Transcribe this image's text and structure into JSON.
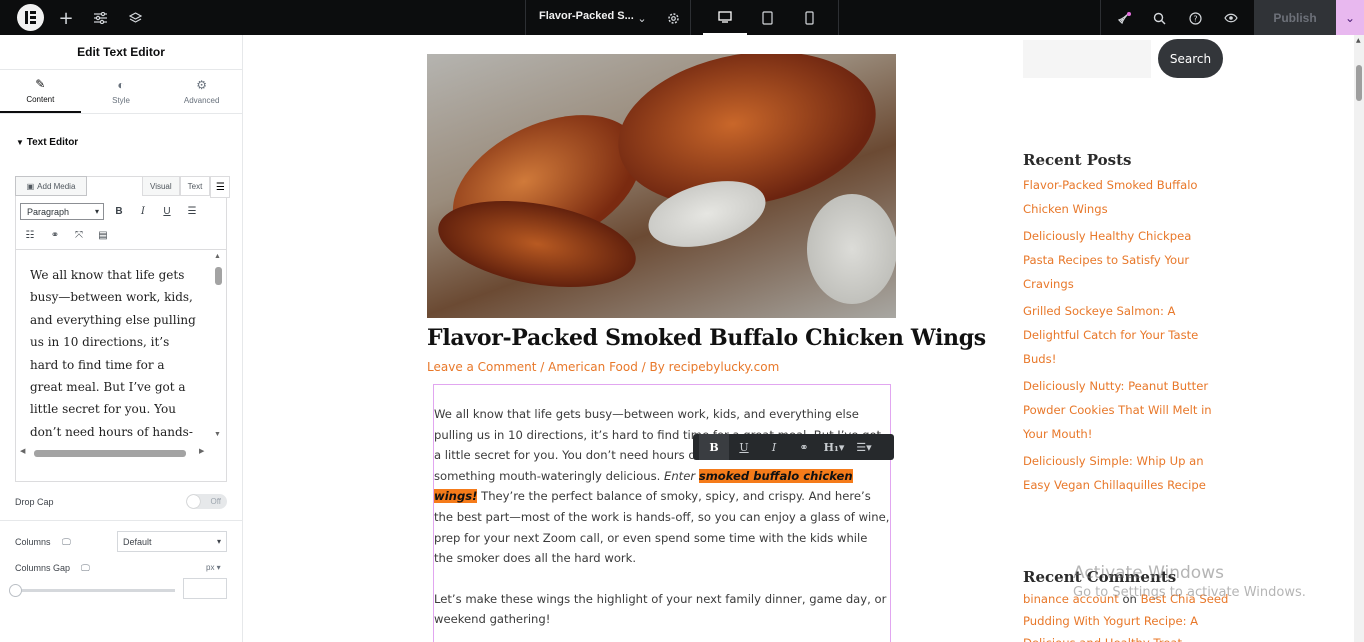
{
  "topbar": {
    "page_title": "Flavor-Packed S...",
    "publish_label": "Publish"
  },
  "panel": {
    "title": "Edit Text Editor",
    "tabs": [
      {
        "label": "Content",
        "icon": "pencil-icon"
      },
      {
        "label": "Style",
        "icon": "half-circle-icon"
      },
      {
        "label": "Advanced",
        "icon": "gear-icon"
      }
    ],
    "section_title": "Text Editor",
    "add_media_label": "Add Media",
    "visual_tab": "Visual",
    "text_tab": "Text",
    "format_select": "Paragraph",
    "editor_text": "We all know that life gets busy—between work, kids, and everything else pulling us in 10 directions, it’s hard to find time for a great meal. But I’ve got a little secret for you. You don’t need hours of hands-on time to make something",
    "drop_cap_label": "Drop Cap",
    "drop_cap_value": "Off",
    "columns_label": "Columns",
    "columns_value": "Default",
    "columns_gap_label": "Columns Gap",
    "columns_gap_unit": "px"
  },
  "post": {
    "title": "Flavor-Packed Smoked Buffalo Chicken Wings",
    "meta": "Leave a Comment / American Food / By recipebylucky.com",
    "para1_before": "We all know that life gets busy—between work, kids, and everything else pulling us in 10 directions, it’s hard to find time for a great meal. But I’ve got a little secret for you. You don’t need hours of hands-on time to make something mouth-wateringly delicious. ",
    "para1_enter": "Enter ",
    "para1_highlight": "smoked buffalo chicken wings",
    "para1_bang": "!",
    "para1_after": " They’re the perfect balance of smoky, spicy, and crispy. And here’s the best part—most of the work is hands-off, so you can enjoy a glass of wine, prep for your next Zoom call, or even spend some time with the kids while the smoker does all the hard work.",
    "para2": "Let’s make these wings the highlight of your next family dinner, game day, or weekend gathering!"
  },
  "sidebar": {
    "search_label": "Search",
    "recent_posts_title": "Recent Posts",
    "recent_posts": [
      "Flavor-Packed Smoked Buffalo Chicken Wings",
      "Deliciously Healthy Chickpea Pasta Recipes to Satisfy Your Cravings",
      "Grilled Sockeye Salmon: A Delightful Catch for Your Taste Buds!",
      "Deliciously Nutty: Peanut Butter Powder Cookies That Will Melt in Your Mouth!",
      "Deliciously Simple: Whip Up an Easy Vegan Chillaquilles Recipe"
    ],
    "recent_comments_title": "Recent Comments",
    "comment_author": "binance account",
    "comment_on": "on",
    "comment_post": "Best Chia Seed Pudding With Yogurt Recipe: A Delicious and Healthy Treat"
  },
  "watermark": {
    "line1": "Activate Windows",
    "line2": "Go to Settings to activate Windows."
  }
}
